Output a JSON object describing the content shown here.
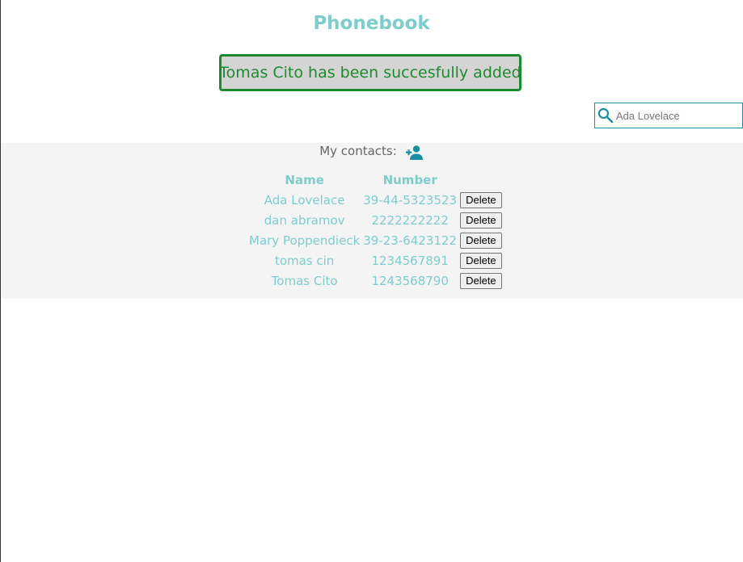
{
  "app": {
    "title": "Phonebook"
  },
  "notification": {
    "message": "Tomas Cito has been succesfully added"
  },
  "search": {
    "icon": "search-icon",
    "placeholder": "Ada Lovelace"
  },
  "contacts": {
    "label": "My contacts:",
    "add_icon": "add-person-icon",
    "columns": [
      "Name",
      "Number"
    ],
    "rows": [
      {
        "name": "Ada Lovelace",
        "number": "39-44-5323523",
        "action": "Delete"
      },
      {
        "name": "dan abramov",
        "number": "2222222222",
        "action": "Delete"
      },
      {
        "name": "Mary Poppendieck",
        "number": "39-23-6423122",
        "action": "Delete"
      },
      {
        "name": "tomas cin",
        "number": "1234567891",
        "action": "Delete"
      },
      {
        "name": "Tomas Cito",
        "number": "1243568790",
        "action": "Delete"
      }
    ]
  },
  "colors": {
    "accent": "#7ecdcd",
    "success": "#1e8a2e",
    "icon": "#1b8fa0",
    "panel_bg": "#f4f4f4"
  }
}
